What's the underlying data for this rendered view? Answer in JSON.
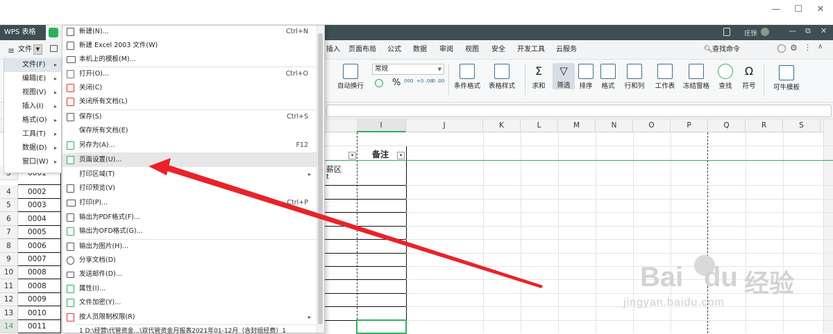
{
  "app": {
    "brand": "WPS 表格",
    "user": "庄徐"
  },
  "menubar": {
    "file_label": "文件",
    "tabs": [
      "插入",
      "页面布局",
      "公式",
      "数据",
      "审阅",
      "视图",
      "安全",
      "开发工具",
      "云服务"
    ],
    "search": "查找命令"
  },
  "toolbar": {
    "autowrap": "自动换行",
    "format_select": "常规",
    "percent": "%",
    "dec1": "000",
    "dec2": "+0 .00",
    "dec3": "-0 .00",
    "buttons": [
      "条件格式",
      "表格样式",
      "求和",
      "筛选",
      "排序",
      "格式",
      "行和列",
      "工作表",
      "冻结窗格",
      "查找",
      "符号",
      "可牛模板"
    ]
  },
  "columns": [
    "I",
    "J",
    "K",
    "L",
    "M",
    "N",
    "O",
    "P",
    "Q",
    "R",
    "S"
  ],
  "rows": [
    "3",
    "4",
    "5",
    "6",
    "7",
    "8",
    "9",
    "10",
    "11",
    "12",
    "13",
    "14"
  ],
  "cells_a": [
    "0001",
    "0002",
    "0003",
    "0004",
    "0005",
    "0006",
    "0007",
    "0008",
    "0008",
    "0009",
    "0010",
    "0011"
  ],
  "sheet": {
    "header_beizhu": "备注",
    "partial_text": "薪区",
    "partial_text2": "t"
  },
  "left_menu": [
    {
      "label": "文件(F)"
    },
    {
      "label": "编辑(E)"
    },
    {
      "label": "视图(V)"
    },
    {
      "label": "插入(I)"
    },
    {
      "label": "格式(O)"
    },
    {
      "label": "工具(T)"
    },
    {
      "label": "数据(D)"
    },
    {
      "label": "窗口(W)"
    }
  ],
  "file_menu": [
    {
      "label": "新建(N)...",
      "shortcut": "Ctrl+N",
      "icon": "new-doc-icon"
    },
    {
      "label": "新建 Excel 2003 文件(W)",
      "shortcut": "",
      "icon": "new-doc-icon"
    },
    {
      "label": "本机上的模板(M)...",
      "shortcut": "",
      "icon": "template-icon"
    },
    {
      "label": "打开(O)...",
      "shortcut": "Ctrl+O",
      "icon": "open-icon"
    },
    {
      "label": "关闭(C)",
      "shortcut": "",
      "icon": "close-doc-icon"
    },
    {
      "label": "关闭所有文档(L)",
      "shortcut": "",
      "icon": "close-all-icon"
    },
    {
      "label": "保存(S)",
      "shortcut": "Ctrl+S",
      "icon": "save-icon"
    },
    {
      "label": "保存所有文档(E)",
      "shortcut": "",
      "icon": ""
    },
    {
      "label": "另存为(A)...",
      "shortcut": "F12",
      "icon": "save-as-icon"
    },
    {
      "label": "页面设置(U)...",
      "shortcut": "",
      "icon": "page-setup-icon"
    },
    {
      "label": "打印区域(T)",
      "shortcut": "",
      "icon": ""
    },
    {
      "label": "打印预览(V)",
      "shortcut": "",
      "icon": "print-preview-icon"
    },
    {
      "label": "打印(P)...",
      "shortcut": "Ctrl+P",
      "icon": "print-icon"
    },
    {
      "label": "输出为PDF格式(F)...",
      "shortcut": "",
      "icon": "pdf-icon"
    },
    {
      "label": "输出为OFD格式(G)...",
      "shortcut": "",
      "icon": "ofd-icon"
    },
    {
      "label": "输出为图片(H)...",
      "shortcut": "",
      "icon": "image-icon"
    },
    {
      "label": "分享文档(D)",
      "shortcut": "",
      "icon": "share-icon"
    },
    {
      "label": "发送邮件(D)...",
      "shortcut": "",
      "icon": "mail-icon"
    },
    {
      "label": "属性(I)...",
      "shortcut": "",
      "icon": "properties-icon"
    },
    {
      "label": "文件加密(Y)...",
      "shortcut": "",
      "icon": "encrypt-icon"
    },
    {
      "label": "按人员限制权限(R)",
      "shortcut": "",
      "icon": "permission-icon"
    },
    {
      "label": "1 D:\\经营\\代管资金...\\双代管资金月报表2021年01-12月（含封组经费）1",
      "shortcut": "",
      "icon": ""
    }
  ],
  "watermark": {
    "text1": "Bai",
    "text2": "du",
    "text3": "经验",
    "url": "jingyan.baidu.com"
  },
  "colors": {
    "tabbar": "#3d4f52",
    "accent": "#2fae5e",
    "arrow": "#e8232a"
  }
}
